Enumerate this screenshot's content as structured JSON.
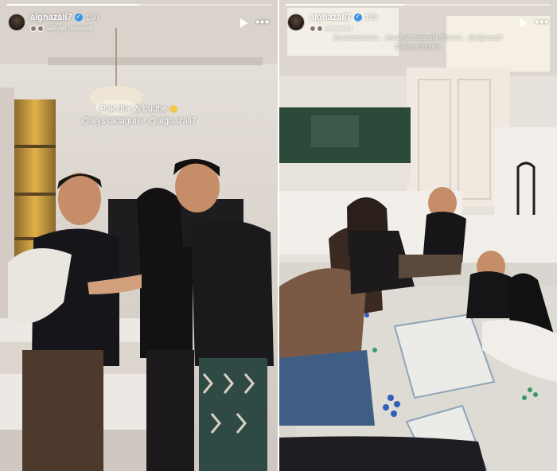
{
  "stories": [
    {
      "username": "alghazali7",
      "time": "16h",
      "collab": "aaliyah.massaid",
      "caption_line1": "Pak dhe & budhe",
      "caption_line2": "@alyssadaguise @alghazali7",
      "progress": 0.5
    },
    {
      "username": "alghazali7",
      "time": "13h",
      "collab": "anissaica",
      "mentions_line1": "@cadlarafataha... @aaliyah.massaid @fahmi... @alghazali7",
      "mentions_line2": "@alyssadaguise",
      "progress": 0.45
    }
  ],
  "icons": {
    "play": "play-icon",
    "more": "more-icon",
    "verified": "verified-badge-icon"
  },
  "colors": {
    "verified": "#3897f0"
  }
}
